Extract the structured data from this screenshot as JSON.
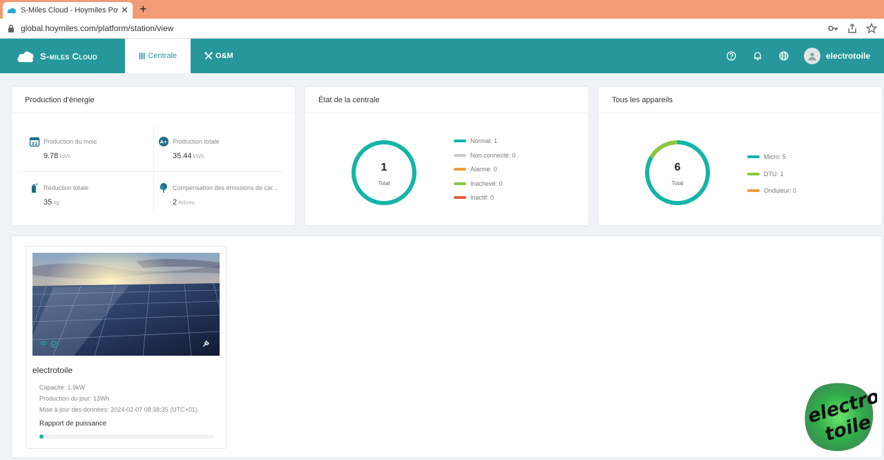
{
  "browser": {
    "tab_title": "S-Miles Cloud - Hoymiles Power",
    "url": "global.hoymiles.com/platform/station/view",
    "new_tab_symbol": "+"
  },
  "header": {
    "brand": "S-miles Cloud",
    "nav": [
      {
        "label": "Centrale",
        "active": true
      },
      {
        "label": "O&M",
        "active": false
      }
    ],
    "username": "electrotoile"
  },
  "energy": {
    "title": "Production d'énergie",
    "month": {
      "label": "Production du mois",
      "value": "9.78",
      "unit": "kWh"
    },
    "total": {
      "label": "Production totale",
      "value": "35.44",
      "unit": "kWh"
    },
    "reduction": {
      "label": "Réduction totale",
      "value": "35",
      "unit": "kg"
    },
    "compensation": {
      "label": "Compensation des émissions de car...",
      "value": "2",
      "unit": "Arbres"
    }
  },
  "plant_state": {
    "title": "État de la centrale",
    "total": "1",
    "total_label": "Total",
    "legend": [
      {
        "label": "Normal: 1",
        "color": "#13b5a6"
      },
      {
        "label": "Non connecté: 0",
        "color": "#c8c8c8"
      },
      {
        "label": "Alarme: 0",
        "color": "#f29d38"
      },
      {
        "label": "Inachevé: 0",
        "color": "#8cc63f"
      },
      {
        "label": "Inactif: 0",
        "color": "#e9573f"
      }
    ],
    "segments": [
      {
        "value": 1,
        "color": "#13b5a6"
      }
    ]
  },
  "devices": {
    "title": "Tous les appareils",
    "total": "6",
    "total_label": "Total",
    "legend": [
      {
        "label": "Micro: 5",
        "color": "#13b5a6"
      },
      {
        "label": "DTU: 1",
        "color": "#8cc63f"
      },
      {
        "label": "Onduleur: 0",
        "color": "#f29d38"
      }
    ],
    "segments": [
      {
        "value": 5,
        "color": "#13b5a6"
      },
      {
        "value": 1,
        "color": "#8cc63f"
      }
    ]
  },
  "station": {
    "name": "electrotoile",
    "capacity": "Capacité: 1.9kW",
    "daily": "Production du jour: 13Wh",
    "updated": "Mise à jour des données: 2024-02-07 08:38:35 (UTC+01)",
    "power_ratio_label": "Rapport de puissance",
    "power_ratio": 0.02
  },
  "watermark": {
    "line1": "electro",
    "line2": "toile"
  }
}
